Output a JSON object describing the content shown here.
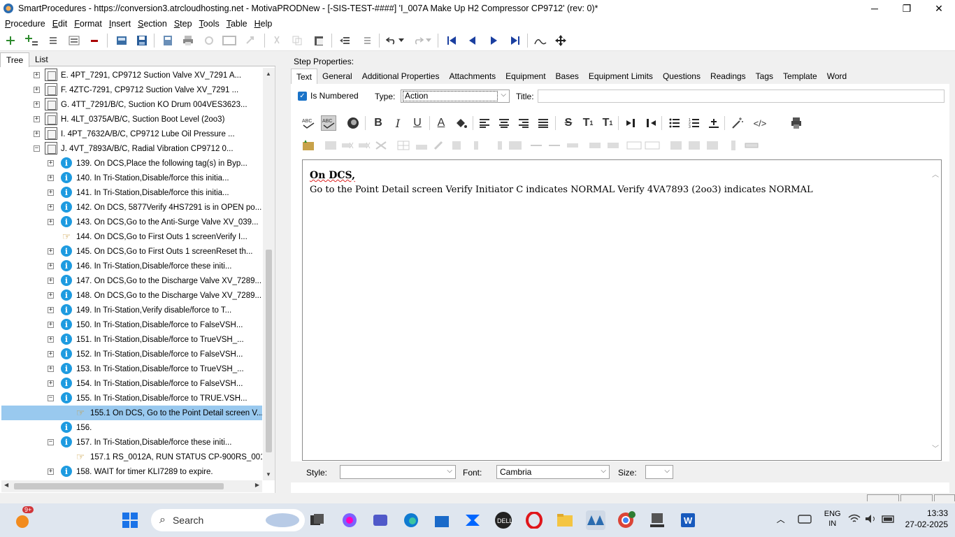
{
  "window": {
    "title": "SmartProcedures - https://conversion3.atrcloudhosting.net - MotivaPRODNew - [-SIS-TEST-####] 'I_007A Make Up H2 Compressor CP9712' (rev: 0)*",
    "min": "─",
    "max": "❐",
    "close": "✕"
  },
  "menu": [
    "Procedure",
    "Edit",
    "Format",
    "Insert",
    "Section",
    "Step",
    "Tools",
    "Table",
    "Help"
  ],
  "left_tabs": [
    "Tree",
    "List"
  ],
  "tree": [
    {
      "level": 1,
      "icon": "section",
      "expand": "+",
      "label": "E. 4PT_7291, CP9712 Suction Valve XV_7291 A..."
    },
    {
      "level": 1,
      "icon": "section",
      "expand": "+",
      "label": "F. 4ZTC-7291, CP9712 Suction Valve XV_7291 ..."
    },
    {
      "level": 1,
      "icon": "section",
      "expand": "+",
      "label": "G. 4TT_7291/B/C, Suction KO Drum 004VES3623..."
    },
    {
      "level": 1,
      "icon": "section",
      "expand": "+",
      "label": "H. 4LT_0375A/B/C, Suction Boot Level (2oo3)"
    },
    {
      "level": 1,
      "icon": "section",
      "expand": "+",
      "label": "I. 4PT_7632A/B/C, CP9712 Lube Oil Pressure ..."
    },
    {
      "level": 1,
      "icon": "section",
      "expand": "−",
      "label": "J. 4VT_7893A/B/C, Radial Vibration CP9712 0..."
    },
    {
      "level": 2,
      "icon": "info",
      "expand": "+",
      "label": "139. On DCS,Place the following tag(s) in Byp..."
    },
    {
      "level": 2,
      "icon": "info",
      "expand": "+",
      "label": "140. In Tri-Station,Disable/force this initia..."
    },
    {
      "level": 2,
      "icon": "info",
      "expand": "+",
      "label": "141. In Tri-Station,Disable/force this initia..."
    },
    {
      "level": 2,
      "icon": "info",
      "expand": "+",
      "label": "142. On DCS, 5877Verify 4HS7291 is in OPEN po..."
    },
    {
      "level": 2,
      "icon": "info",
      "expand": "+",
      "label": "143. On DCS,Go to the Anti-Surge Valve XV_039..."
    },
    {
      "level": 2,
      "icon": "hand",
      "expand": "",
      "label": "144. On DCS,Go to First Outs 1 screenVerify I..."
    },
    {
      "level": 2,
      "icon": "info",
      "expand": "+",
      "label": "145. On DCS,Go to First Outs 1 screenReset th..."
    },
    {
      "level": 2,
      "icon": "info",
      "expand": "+",
      "label": "146. In Tri-Station,Disable/force these initi..."
    },
    {
      "level": 2,
      "icon": "info",
      "expand": "+",
      "label": "147. On DCS,Go to the Discharge Valve XV_7289..."
    },
    {
      "level": 2,
      "icon": "info",
      "expand": "+",
      "label": "148. On DCS,Go to the Discharge Valve XV_7289..."
    },
    {
      "level": 2,
      "icon": "info",
      "expand": "+",
      "label": "149. In Tri-Station,Verify disable/force to T..."
    },
    {
      "level": 2,
      "icon": "info",
      "expand": "+",
      "label": "150. In Tri-Station,Disable/force to FalseVSH..."
    },
    {
      "level": 2,
      "icon": "info",
      "expand": "+",
      "label": "151. In Tri-Station,Disable/force to TrueVSH_..."
    },
    {
      "level": 2,
      "icon": "info",
      "expand": "+",
      "label": "152. In Tri-Station,Disable/force to FalseVSH..."
    },
    {
      "level": 2,
      "icon": "info",
      "expand": "+",
      "label": "153. In Tri-Station,Disable/force to TrueVSH_..."
    },
    {
      "level": 2,
      "icon": "info",
      "expand": "+",
      "label": "154. In Tri-Station,Disable/force to FalseVSH..."
    },
    {
      "level": 2,
      "icon": "info",
      "expand": "−",
      "label": "155. In Tri-Station,Disable/force to TRUE.VSH..."
    },
    {
      "level": 3,
      "icon": "hand",
      "expand": "",
      "label": "155.1 On DCS, Go to the Point Detail screen V...",
      "selected": true
    },
    {
      "level": 2,
      "icon": "info",
      "expand": "",
      "label": "156."
    },
    {
      "level": 2,
      "icon": "info",
      "expand": "−",
      "label": "157. In Tri-Station,Disable/force these initi..."
    },
    {
      "level": 3,
      "icon": "hand",
      "expand": "",
      "label": "157.1  RS_0012A, RUN STATUS CP-900RS_001..."
    },
    {
      "level": 2,
      "icon": "info",
      "expand": "+",
      "label": "158. WAIT for timer KLI7289 to expire."
    }
  ],
  "props": {
    "heading": "Step Properties:",
    "tabs": [
      "Text",
      "General",
      "Additional Properties",
      "Attachments",
      "Equipment",
      "Bases",
      "Equipment Limits",
      "Questions",
      "Readings",
      "Tags",
      "Template",
      "Word"
    ],
    "is_numbered": "Is Numbered",
    "type_label": "Type:",
    "type_value": "Action",
    "title_label": "Title:"
  },
  "editor": {
    "heading": "On DCS,",
    "body": "Go to the Point Detail screen Verify Initiator C indicates NORMAL Verify 4VA7893 (2oo3) indicates NORMAL"
  },
  "bottom": {
    "style_label": "Style:",
    "font_label": "Font:",
    "font_value": "Cambria",
    "size_label": "Size:"
  },
  "taskbar": {
    "search": "Search",
    "badge": "9+",
    "lang1": "ENG",
    "lang2": "IN",
    "time": "13:33",
    "date": "27-02-2025"
  }
}
